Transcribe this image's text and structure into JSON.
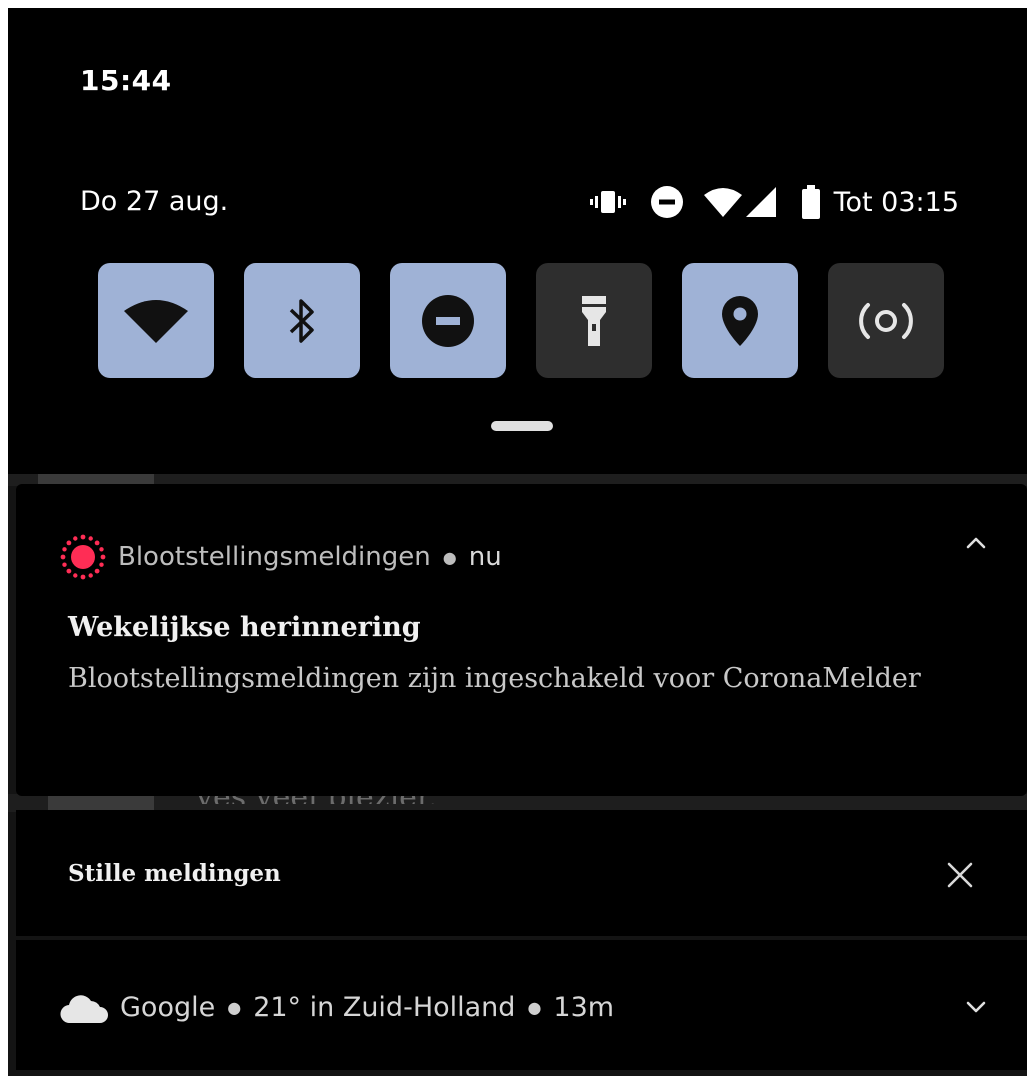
{
  "status_bar": {
    "clock": "15:44",
    "date": "Do 27 aug.",
    "battery_text": "Tot 03:15",
    "icons": [
      "vibrate-icon",
      "do-not-disturb-icon",
      "wifi-icon",
      "cell-signal-icon",
      "battery-icon"
    ]
  },
  "quick_settings": {
    "tiles": [
      {
        "name": "wifi",
        "icon": "wifi-icon",
        "active": true
      },
      {
        "name": "bluetooth",
        "icon": "bluetooth-icon",
        "active": true
      },
      {
        "name": "do-not-disturb",
        "icon": "do-not-disturb-icon",
        "active": true
      },
      {
        "name": "flashlight",
        "icon": "flashlight-icon",
        "active": false
      },
      {
        "name": "location",
        "icon": "location-pin-icon",
        "active": true
      },
      {
        "name": "hotspot",
        "icon": "hotspot-icon",
        "active": false
      }
    ],
    "active_color": "#9fb2d6",
    "inactive_color": "#2e2e2e"
  },
  "background_app": {
    "peek_text": "yes veel plezier."
  },
  "notification": {
    "app_name": "Blootstellingsmeldingen",
    "time": "nu",
    "title": "Wekelijkse herinnering",
    "body": "Blootstellingsmeldingen zijn ingeschakeld voor CoronaMelder",
    "app_icon_color": "#ff2d55"
  },
  "silent_section": {
    "label": "Stille meldingen"
  },
  "google_notification": {
    "app_name": "Google",
    "weather": "21° in Zuid-Holland",
    "time": "13m"
  }
}
